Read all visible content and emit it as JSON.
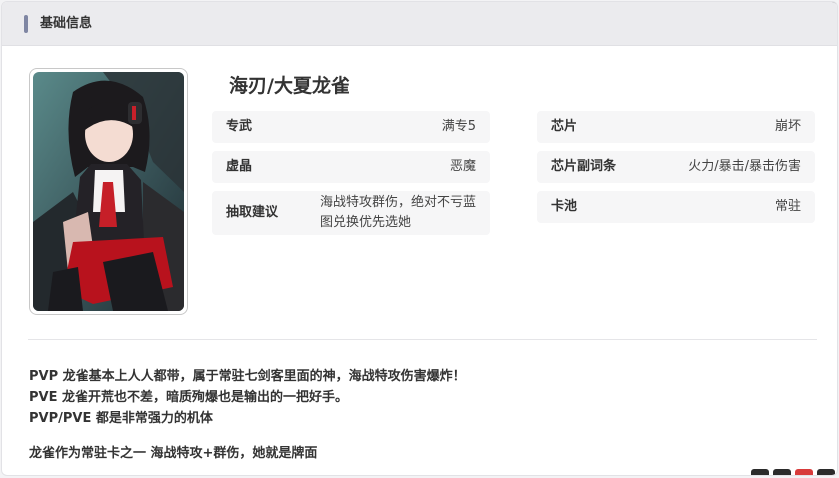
{
  "header": {
    "title": "基础信息"
  },
  "character": {
    "name": "海刃/大夏龙雀"
  },
  "left_rows": [
    {
      "label": "专武",
      "value": "满专5"
    },
    {
      "label": "虚晶",
      "value": "恶魔"
    },
    {
      "label": "抽取建议",
      "value": "海战特攻群伤，绝对不亏蓝图兑换优先选她"
    }
  ],
  "right_rows": [
    {
      "label": "芯片",
      "value": "崩坏"
    },
    {
      "label": "芯片副词条",
      "value": "火力/暴击/暴击伤害"
    },
    {
      "label": "卡池",
      "value": "常驻"
    }
  ],
  "description": [
    "PVP 龙雀基本上人人都带，属于常驻七剑客里面的神，海战特攻伤害爆炸！",
    "PVE 龙雀开荒也不差，暗质殉爆也是输出的一把好手。",
    "PVP/PVE 都是非常强力的机体",
    "龙雀作为常驻卡之一 海战特攻+群伤，她就是牌面"
  ],
  "colors": {
    "accent_bar": "#7f86a3",
    "header_bg": "#ebebee",
    "cell_bg": "#f6f6f7"
  }
}
